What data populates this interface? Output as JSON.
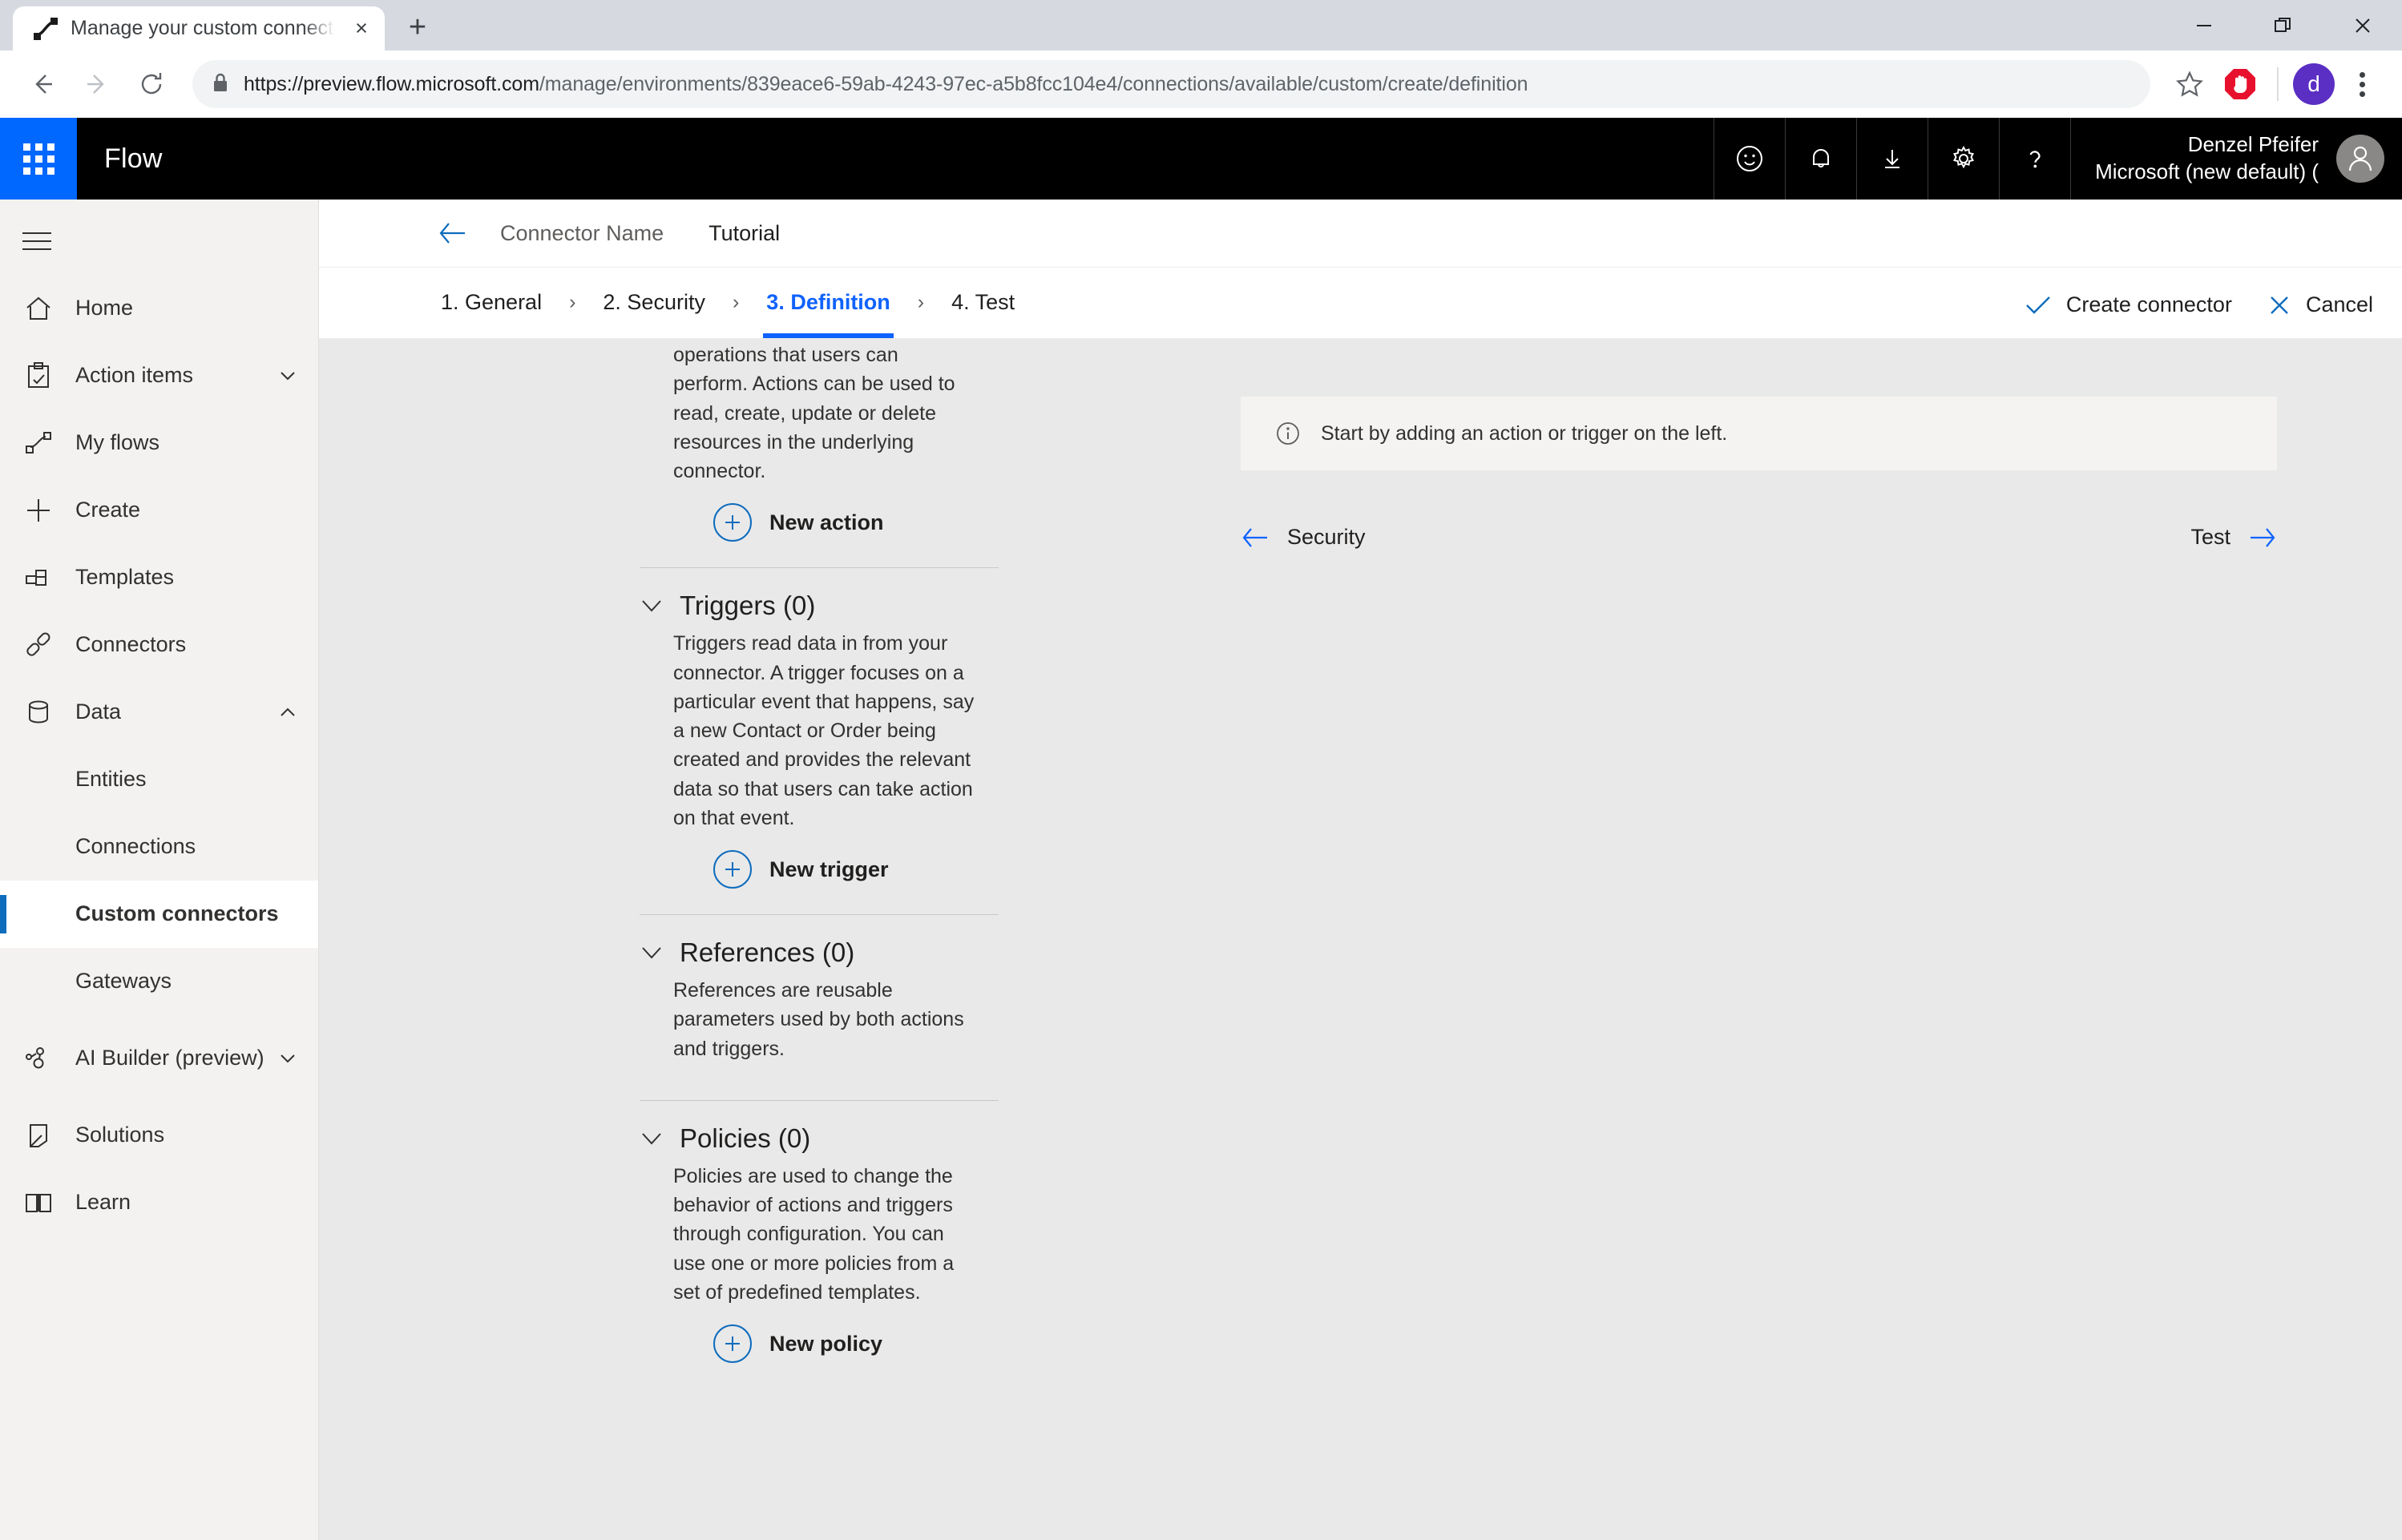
{
  "browser": {
    "tab": {
      "title": "Manage your custom connectors",
      "favicon_name": "flow-favicon",
      "close_label": "×"
    },
    "new_tab_label": "+",
    "window_controls": {
      "minimize": "minimize-button",
      "restore": "restore-button",
      "close": "close-button"
    },
    "url": {
      "scheme_host": "https://preview.flow.microsoft.com",
      "path": "/manage/environments/839eace6-59ab-4243-97ec-a5b8fcc104e4/connections/available/custom/create/definition"
    },
    "profile_initial": "d"
  },
  "header": {
    "brand": "Flow",
    "waffle_name": "app-launcher-waffle",
    "icons": [
      "smiley-icon",
      "bell-icon",
      "download-icon",
      "gear-icon",
      "help-icon"
    ],
    "user_name": "Denzel Pfeifer",
    "user_org": "Microsoft (new default) (",
    "accent": "#0067ff"
  },
  "sidebar": {
    "items": [
      {
        "label": "Home",
        "icon": "home-icon",
        "chevron": "",
        "sub": false,
        "active": false
      },
      {
        "label": "Action items",
        "icon": "clipboard-check-icon",
        "chevron": "down",
        "sub": false,
        "active": false
      },
      {
        "label": "My flows",
        "icon": "flow-icon",
        "chevron": "",
        "sub": false,
        "active": false
      },
      {
        "label": "Create",
        "icon": "plus-icon",
        "chevron": "",
        "sub": false,
        "active": false
      },
      {
        "label": "Templates",
        "icon": "templates-icon",
        "chevron": "",
        "sub": false,
        "active": false
      },
      {
        "label": "Connectors",
        "icon": "connectors-icon",
        "chevron": "",
        "sub": false,
        "active": false
      },
      {
        "label": "Data",
        "icon": "database-icon",
        "chevron": "up",
        "sub": false,
        "active": false
      },
      {
        "label": "Entities",
        "icon": "",
        "chevron": "",
        "sub": true,
        "active": false
      },
      {
        "label": "Connections",
        "icon": "",
        "chevron": "",
        "sub": true,
        "active": false
      },
      {
        "label": "Custom connectors",
        "icon": "",
        "chevron": "",
        "sub": true,
        "active": true
      },
      {
        "label": "Gateways",
        "icon": "",
        "chevron": "",
        "sub": true,
        "active": false
      },
      {
        "label": "AI Builder (preview)",
        "icon": "ai-builder-icon",
        "chevron": "down",
        "sub": false,
        "active": false
      },
      {
        "label": "Solutions",
        "icon": "solutions-icon",
        "chevron": "",
        "sub": false,
        "active": false
      },
      {
        "label": "Learn",
        "icon": "book-icon",
        "chevron": "",
        "sub": false,
        "active": false
      }
    ],
    "active_accent": "#0f6cbd"
  },
  "breadcrumb": {
    "back_icon": "back-arrow-icon",
    "connector_name": "Connector Name",
    "tutorial": "Tutorial"
  },
  "wizard": {
    "steps": [
      {
        "label": "1. General",
        "active": false
      },
      {
        "label": "2. Security",
        "active": false
      },
      {
        "label": "3. Definition",
        "active": true
      },
      {
        "label": "4. Test",
        "active": false
      }
    ],
    "separator": "›",
    "active_color": "#0f62fe",
    "create_label": "Create connector",
    "cancel_label": "Cancel"
  },
  "definition_panel": {
    "actions_tail_text": "operations that users can perform. Actions can be used to read, create, update or delete resources in the underlying connector.",
    "new_action_label": "New action",
    "sections": [
      {
        "title": "Triggers (0)",
        "desc": "Triggers read data in from your connector. A trigger focuses on a particular event that happens, say a new Contact or Order being created and provides the relevant data so that users can take action on that event.",
        "button": "New trigger"
      },
      {
        "title": "References (0)",
        "desc": "References are reusable parameters used by both actions and triggers.",
        "button": ""
      },
      {
        "title": "Policies (0)",
        "desc": "Policies are used to change the behavior of actions and triggers through configuration. You can use one or more policies from a set of predefined templates.",
        "button": "New policy"
      }
    ]
  },
  "canvas": {
    "info_message": "Start by adding an action or trigger on the left.",
    "prev_label": "Security",
    "next_label": "Test"
  }
}
